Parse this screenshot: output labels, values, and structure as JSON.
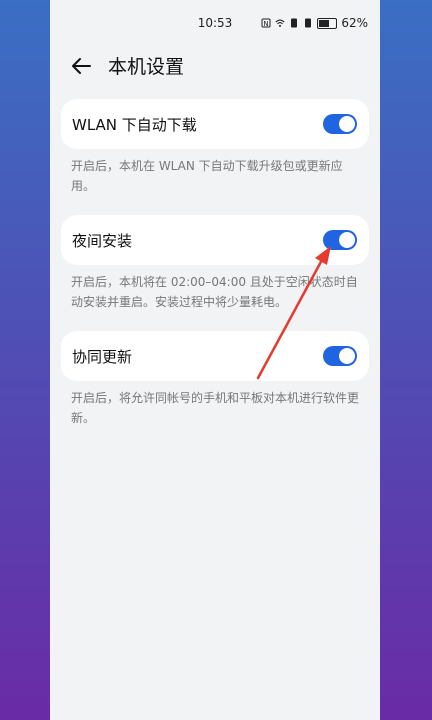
{
  "status": {
    "time": "10:53",
    "battery": "62%"
  },
  "header": {
    "title": "本机设置"
  },
  "settings": [
    {
      "label": "WLAN 下自动下载",
      "enabled": true,
      "description": "开启后，本机在 WLAN 下自动下载升级包或更新应用。"
    },
    {
      "label": "夜间安装",
      "enabled": true,
      "description": "开启后，本机将在 02:00–04:00 且处于空闲状态时自动安装并重启。安装过程中将少量耗电。"
    },
    {
      "label": "协同更新",
      "enabled": true,
      "description": "开启后，将允许同帐号的手机和平板对本机进行软件更新。"
    }
  ],
  "colors": {
    "accent": "#1f64e0",
    "annotation_arrow": "#e53a2f"
  }
}
